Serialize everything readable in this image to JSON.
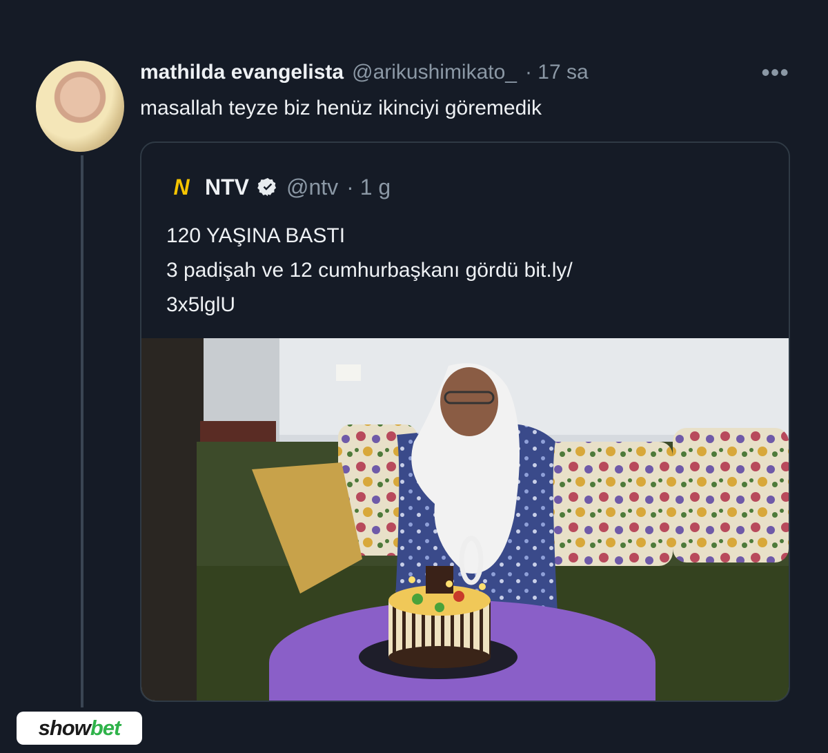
{
  "tweet": {
    "author_name": "mathilda evangelista",
    "handle": "@arikushimikato_",
    "time": "· 17 sa",
    "text": "masallah teyze biz henüz ikinciyi göremedik",
    "avatar": "user-avatar-photo",
    "more_icon": "more-options-icon"
  },
  "quote": {
    "logo": "N",
    "name": "NTV",
    "verified": "verified-badge-icon",
    "handle": "@ntv",
    "time": "· 1 g",
    "lines": [
      "120 YAŞINA BASTI",
      "3 padişah ve 12 cumhurbaşkanı gördü bit.ly/",
      "3x5lglU"
    ],
    "image": "elderly-woman-with-birthday-cake-photo"
  },
  "watermark": {
    "show": "show",
    "bet": "bet"
  },
  "colors": {
    "background": "#151b26",
    "text": "#eef1f4",
    "muted": "#8b98a5",
    "border": "#2f3a45",
    "brand_yellow": "#f5c400",
    "brand_green": "#2fb34a"
  }
}
